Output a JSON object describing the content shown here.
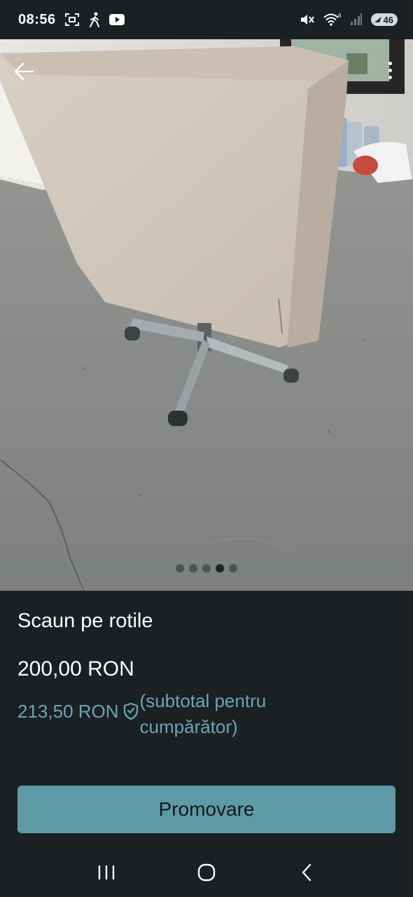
{
  "status_bar": {
    "time": "08:56",
    "battery": "46",
    "wifi_badge": "6",
    "icons": [
      "screenshot-icon",
      "walking-icon",
      "youtube-icon",
      "mute-icon",
      "wifi-icon",
      "signal-icon",
      "battery-icon"
    ]
  },
  "gallery": {
    "image": "office-chair-photo",
    "dot_count": 5,
    "active_index": 3
  },
  "listing": {
    "title": "Scaun pe rotile",
    "price": "200,00 RON",
    "buyer_price": "213,50 RON",
    "buyer_note": "(subtotal pentru cumpărător)"
  },
  "actions": {
    "promote_label": "Promovare"
  },
  "colors": {
    "background": "#1b2023",
    "accent": "#5d9aa6",
    "accent_text": "#6aa6b3"
  }
}
